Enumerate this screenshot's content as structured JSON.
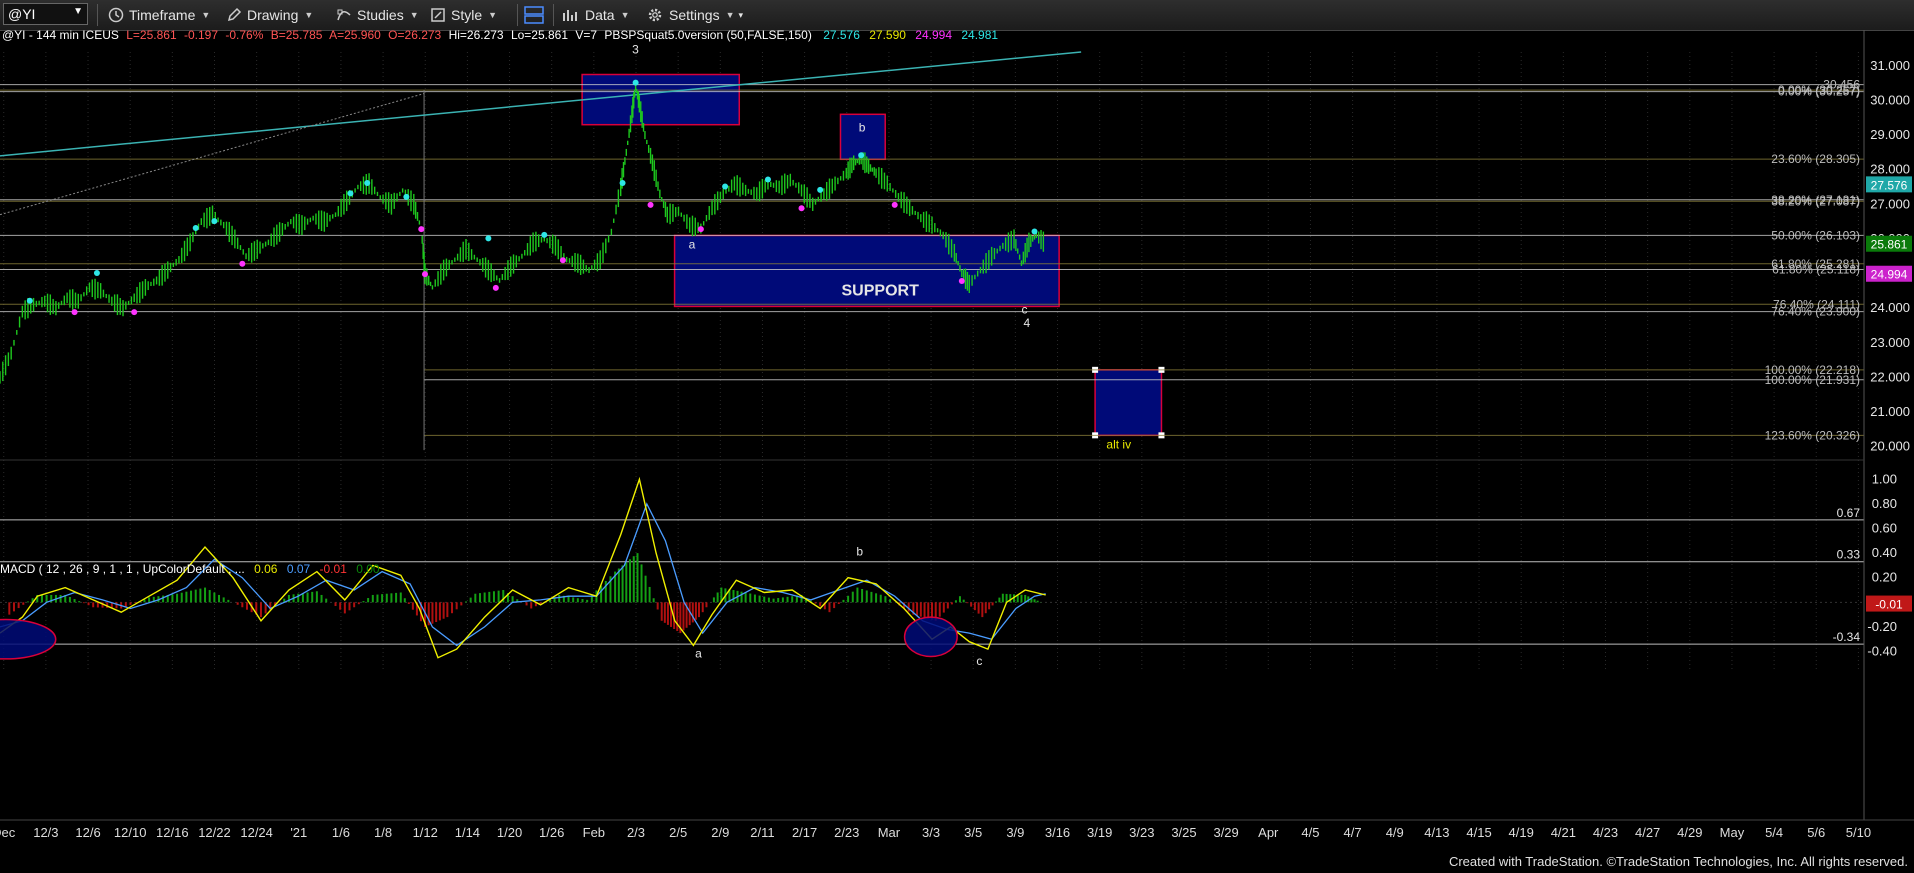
{
  "toolbar": {
    "symbol": "@YI",
    "timeframe": "Timeframe",
    "drawing": "Drawing",
    "studies": "Studies",
    "style": "Style",
    "data": "Data",
    "settings": "Settings"
  },
  "header": {
    "symbol_info": "@YI - 144 min  ICEUS",
    "last": "L=25.861",
    "change": "-0.197",
    "change_pct": "-0.76%",
    "bid": "B=25.785",
    "ask": "A=25.960",
    "open": "O=26.273",
    "high": "Hi=26.273",
    "low": "Lo=25.861",
    "volume": "V=7",
    "indicator": "PBSPSquat5.0version (50,FALSE,150)",
    "ind_vals": [
      "27.576",
      "27.590",
      "24.994",
      "24.981"
    ]
  },
  "macd_header": {
    "label": "MACD ( 12 , 26 , 9 , 1 , 1 , UpColorDefault , ...",
    "vals": [
      "0.06",
      "0.07",
      "-0.01",
      "0.00"
    ]
  },
  "footer": "Created with TradeStation. ©TradeStation Technologies, Inc. All rights reserved.",
  "colors": {
    "up_text": "#ff5555",
    "yellow": "#e8e800",
    "cyan": "#2ee6e6",
    "magenta": "#ff33ff",
    "box": "#000a78",
    "box_border": "#d9003a",
    "hist_up": "#14a014",
    "hist_down": "#b01010"
  },
  "chart_data": {
    "type": "candlestick",
    "price_axis": {
      "ticks": [
        "31.000",
        "30.000",
        "29.000",
        "28.000",
        "27.000",
        "26.000",
        "25.000",
        "24.000",
        "23.000",
        "22.000",
        "21.000",
        "20.000"
      ],
      "range": [
        19.7,
        31.4
      ]
    },
    "date_axis": {
      "ticks": [
        "Dec",
        "12/3",
        "12/6",
        "12/10",
        "12/16",
        "12/22",
        "12/24",
        "'21",
        "1/6",
        "1/8",
        "1/12",
        "1/14",
        "1/20",
        "1/26",
        "Feb",
        "2/3",
        "2/5",
        "2/9",
        "2/11",
        "2/17",
        "2/23",
        "Mar",
        "3/3",
        "3/5",
        "3/9",
        "3/16",
        "3/19",
        "3/23",
        "3/25",
        "3/29",
        "Apr",
        "4/5",
        "4/7",
        "4/9",
        "4/13",
        "4/15",
        "4/19",
        "4/21",
        "4/23",
        "4/27",
        "4/29",
        "May",
        "5/4",
        "5/6",
        "5/10"
      ]
    },
    "price_labels": [
      {
        "text": "27.576",
        "value": 27.576,
        "bg": "#1fa8a8",
        "fg": "#fff"
      },
      {
        "text": "25.861",
        "value": 25.861,
        "bg": "#0a7a0a",
        "fg": "#fff"
      },
      {
        "text": "24.994",
        "value": 24.994,
        "bg": "#cc22cc",
        "fg": "#fff"
      }
    ],
    "fib_levels": [
      {
        "text": "30.456",
        "value": 30.456
      },
      {
        "text": "0.00% (30.257)",
        "value": 30.3
      },
      {
        "text": "0.00% (30.257)",
        "value": 30.257
      },
      {
        "text": "23.60% (28.305)",
        "value": 28.305
      },
      {
        "text": "38.20% (27.131)",
        "value": 27.131
      },
      {
        "text": "38.20% (27.087)",
        "value": 27.087
      },
      {
        "text": "50.00% (26.103)",
        "value": 26.103
      },
      {
        "text": "61.80% (25.281)",
        "value": 25.281
      },
      {
        "text": "61.80% (25.118)",
        "value": 25.118
      },
      {
        "text": "76.40% (24.111)",
        "value": 24.111
      },
      {
        "text": "76.40% (23.900)",
        "value": 23.9
      },
      {
        "text": "100.00% (22.218)",
        "value": 22.218
      },
      {
        "text": "100.00% (21.931)",
        "value": 21.931
      },
      {
        "text": "123.60% (20.326)",
        "value": 20.326
      }
    ],
    "annotations": [
      {
        "text": "3",
        "t": 0.3409,
        "p": 31.35
      },
      {
        "text": "b",
        "t": 0.4625,
        "p": 29.1
      },
      {
        "text": "a",
        "t": 0.3712,
        "p": 25.73
      },
      {
        "text": "SUPPORT",
        "t": 0.4722,
        "p": 24.37
      },
      {
        "text": "c",
        "t": 0.5496,
        "p": 23.85
      },
      {
        "text": "4",
        "t": 0.5509,
        "p": 23.46
      },
      {
        "text": "alt iv",
        "t": 0.6002,
        "p": 19.95
      }
    ],
    "zones": [
      {
        "label": "3",
        "t0": 0.3123,
        "t1": 0.3966,
        "p0": 29.3,
        "p1": 30.75
      },
      {
        "label": "b",
        "t0": 0.4509,
        "t1": 0.4749,
        "p0": 28.3,
        "p1": 29.6
      },
      {
        "label": "SUPPORT",
        "t0": 0.3619,
        "t1": 0.5682,
        "p0": 24.05,
        "p1": 26.1
      },
      {
        "label": "alt iv",
        "t0": 0.5875,
        "t1": 0.6231,
        "p0": 20.326,
        "p1": 22.218
      }
    ],
    "price_series": [
      [
        0,
        22.0
      ],
      [
        0.006,
        22.7
      ],
      [
        0.012,
        23.9
      ],
      [
        0.018,
        24.1
      ],
      [
        0.024,
        24.2
      ],
      [
        0.03,
        24.0
      ],
      [
        0.036,
        24.3
      ],
      [
        0.042,
        24.2
      ],
      [
        0.048,
        24.6
      ],
      [
        0.054,
        24.5
      ],
      [
        0.06,
        24.2
      ],
      [
        0.066,
        24.0
      ],
      [
        0.072,
        24.3
      ],
      [
        0.078,
        24.6
      ],
      [
        0.084,
        24.8
      ],
      [
        0.09,
        25.1
      ],
      [
        0.096,
        25.4
      ],
      [
        0.102,
        25.9
      ],
      [
        0.108,
        26.5
      ],
      [
        0.114,
        26.7
      ],
      [
        0.12,
        26.4
      ],
      [
        0.126,
        26.0
      ],
      [
        0.132,
        25.5
      ],
      [
        0.138,
        25.7
      ],
      [
        0.144,
        25.9
      ],
      [
        0.15,
        26.2
      ],
      [
        0.156,
        26.5
      ],
      [
        0.162,
        26.4
      ],
      [
        0.168,
        26.6
      ],
      [
        0.174,
        26.5
      ],
      [
        0.18,
        26.7
      ],
      [
        0.186,
        27.1
      ],
      [
        0.192,
        27.5
      ],
      [
        0.198,
        27.6
      ],
      [
        0.204,
        27.2
      ],
      [
        0.21,
        27.0
      ],
      [
        0.216,
        27.4
      ],
      [
        0.222,
        27.0
      ],
      [
        0.226,
        26.3
      ],
      [
        0.228,
        25.0
      ],
      [
        0.232,
        24.6
      ],
      [
        0.238,
        25.1
      ],
      [
        0.244,
        25.4
      ],
      [
        0.25,
        25.7
      ],
      [
        0.256,
        25.4
      ],
      [
        0.262,
        25.1
      ],
      [
        0.268,
        24.8
      ],
      [
        0.274,
        25.2
      ],
      [
        0.28,
        25.5
      ],
      [
        0.286,
        25.9
      ],
      [
        0.292,
        26.0
      ],
      [
        0.298,
        25.8
      ],
      [
        0.304,
        25.4
      ],
      [
        0.31,
        25.3
      ],
      [
        0.316,
        25.1
      ],
      [
        0.322,
        25.4
      ],
      [
        0.328,
        26.2
      ],
      [
        0.333,
        27.5
      ],
      [
        0.336,
        28.5
      ],
      [
        0.339,
        29.6
      ],
      [
        0.341,
        30.4
      ],
      [
        0.343,
        29.9
      ],
      [
        0.346,
        29.0
      ],
      [
        0.35,
        28.2
      ],
      [
        0.354,
        27.3
      ],
      [
        0.358,
        26.7
      ],
      [
        0.364,
        26.8
      ],
      [
        0.37,
        26.4
      ],
      [
        0.376,
        26.3
      ],
      [
        0.382,
        26.9
      ],
      [
        0.388,
        27.3
      ],
      [
        0.394,
        27.6
      ],
      [
        0.4,
        27.4
      ],
      [
        0.406,
        27.3
      ],
      [
        0.412,
        27.6
      ],
      [
        0.418,
        27.5
      ],
      [
        0.424,
        27.7
      ],
      [
        0.43,
        27.4
      ],
      [
        0.436,
        27.0
      ],
      [
        0.442,
        27.3
      ],
      [
        0.448,
        27.6
      ],
      [
        0.454,
        27.9
      ],
      [
        0.458,
        28.2
      ],
      [
        0.462,
        28.3
      ],
      [
        0.466,
        28.1
      ],
      [
        0.47,
        27.9
      ],
      [
        0.476,
        27.6
      ],
      [
        0.482,
        27.2
      ],
      [
        0.488,
        26.9
      ],
      [
        0.494,
        26.6
      ],
      [
        0.5,
        26.4
      ],
      [
        0.506,
        26.1
      ],
      [
        0.512,
        25.6
      ],
      [
        0.516,
        25.0
      ],
      [
        0.52,
        24.7
      ],
      [
        0.526,
        25.1
      ],
      [
        0.532,
        25.5
      ],
      [
        0.538,
        25.8
      ],
      [
        0.544,
        26.0
      ],
      [
        0.548,
        25.3
      ],
      [
        0.552,
        25.9
      ],
      [
        0.556,
        26.1
      ],
      [
        0.561,
        25.86
      ]
    ],
    "pivots_high": [
      [
        0.016,
        24.1
      ],
      [
        0.052,
        24.9
      ],
      [
        0.105,
        26.2
      ],
      [
        0.115,
        26.4
      ],
      [
        0.188,
        27.2
      ],
      [
        0.197,
        27.5
      ],
      [
        0.218,
        27.1
      ],
      [
        0.262,
        25.9
      ],
      [
        0.292,
        26.0
      ],
      [
        0.334,
        27.5
      ],
      [
        0.341,
        30.4
      ],
      [
        0.389,
        27.4
      ],
      [
        0.412,
        27.6
      ],
      [
        0.44,
        27.3
      ],
      [
        0.462,
        28.3
      ],
      [
        0.555,
        26.1
      ]
    ],
    "pivots_low": [
      [
        0.04,
        24.0
      ],
      [
        0.072,
        24.0
      ],
      [
        0.13,
        25.4
      ],
      [
        0.226,
        26.4
      ],
      [
        0.228,
        25.1
      ],
      [
        0.266,
        24.7
      ],
      [
        0.302,
        25.5
      ],
      [
        0.349,
        27.1
      ],
      [
        0.376,
        26.4
      ],
      [
        0.43,
        27.0
      ],
      [
        0.48,
        27.1
      ],
      [
        0.516,
        24.9
      ]
    ],
    "macd": {
      "ticks": [
        "1.00",
        "0.80",
        "0.60",
        "0.40",
        "0.20",
        "0.00",
        "-0.20",
        "-0.40"
      ],
      "range": [
        -0.55,
        1.1
      ],
      "hlines": [
        {
          "value": 0.67,
          "label": "0.67"
        },
        {
          "value": 0.33,
          "label": "0.33"
        },
        {
          "value": -0.34,
          "label": "-0.34"
        }
      ],
      "last_label": {
        "text": "-0.01",
        "value": -0.01
      },
      "annotations": [
        {
          "text": "b",
          "t": 0.4612,
          "v": 0.38
        },
        {
          "text": "a",
          "t": 0.3747,
          "v": -0.45
        },
        {
          "text": "c",
          "t": 0.5254,
          "v": -0.51
        }
      ],
      "ellipses": [
        {
          "t": 0.0029,
          "v": -0.3,
          "rt": 0.027,
          "rv": 0.16
        },
        {
          "t": 0.4994,
          "v": -0.28,
          "rt": 0.0141,
          "rv": 0.16
        }
      ],
      "macd_line": [
        [
          0,
          -0.25
        ],
        [
          0.012,
          -0.12
        ],
        [
          0.02,
          0.05
        ],
        [
          0.035,
          0.12
        ],
        [
          0.05,
          0.02
        ],
        [
          0.065,
          -0.08
        ],
        [
          0.08,
          0.05
        ],
        [
          0.095,
          0.18
        ],
        [
          0.11,
          0.45
        ],
        [
          0.125,
          0.2
        ],
        [
          0.14,
          -0.15
        ],
        [
          0.155,
          0.1
        ],
        [
          0.17,
          0.25
        ],
        [
          0.185,
          0.02
        ],
        [
          0.2,
          0.3
        ],
        [
          0.215,
          0.22
        ],
        [
          0.225,
          -0.05
        ],
        [
          0.235,
          -0.45
        ],
        [
          0.245,
          -0.38
        ],
        [
          0.26,
          -0.12
        ],
        [
          0.275,
          0.1
        ],
        [
          0.29,
          -0.02
        ],
        [
          0.305,
          0.12
        ],
        [
          0.32,
          0.05
        ],
        [
          0.333,
          0.55
        ],
        [
          0.343,
          1.0
        ],
        [
          0.352,
          0.4
        ],
        [
          0.362,
          -0.15
        ],
        [
          0.372,
          -0.35
        ],
        [
          0.382,
          -0.1
        ],
        [
          0.395,
          0.18
        ],
        [
          0.41,
          0.08
        ],
        [
          0.425,
          0.1
        ],
        [
          0.44,
          -0.05
        ],
        [
          0.455,
          0.2
        ],
        [
          0.47,
          0.15
        ],
        [
          0.485,
          -0.05
        ],
        [
          0.5,
          -0.3
        ],
        [
          0.51,
          -0.2
        ],
        [
          0.52,
          -0.32
        ],
        [
          0.53,
          -0.38
        ],
        [
          0.54,
          0.0
        ],
        [
          0.55,
          0.1
        ],
        [
          0.561,
          0.06
        ]
      ],
      "signal_line": [
        [
          0,
          -0.2
        ],
        [
          0.012,
          -0.15
        ],
        [
          0.025,
          0.0
        ],
        [
          0.04,
          0.08
        ],
        [
          0.055,
          0.02
        ],
        [
          0.07,
          -0.05
        ],
        [
          0.085,
          0.02
        ],
        [
          0.1,
          0.12
        ],
        [
          0.115,
          0.35
        ],
        [
          0.13,
          0.2
        ],
        [
          0.145,
          -0.05
        ],
        [
          0.16,
          0.05
        ],
        [
          0.175,
          0.18
        ],
        [
          0.19,
          0.1
        ],
        [
          0.205,
          0.25
        ],
        [
          0.22,
          0.15
        ],
        [
          0.232,
          -0.2
        ],
        [
          0.245,
          -0.35
        ],
        [
          0.26,
          -0.2
        ],
        [
          0.275,
          0.0
        ],
        [
          0.29,
          0.02
        ],
        [
          0.305,
          0.05
        ],
        [
          0.32,
          0.05
        ],
        [
          0.335,
          0.3
        ],
        [
          0.347,
          0.8
        ],
        [
          0.357,
          0.5
        ],
        [
          0.367,
          0.0
        ],
        [
          0.377,
          -0.25
        ],
        [
          0.39,
          0.0
        ],
        [
          0.405,
          0.12
        ],
        [
          0.42,
          0.08
        ],
        [
          0.435,
          0.02
        ],
        [
          0.45,
          0.1
        ],
        [
          0.465,
          0.18
        ],
        [
          0.48,
          0.05
        ],
        [
          0.495,
          -0.15
        ],
        [
          0.508,
          -0.22
        ],
        [
          0.52,
          -0.25
        ],
        [
          0.532,
          -0.3
        ],
        [
          0.545,
          -0.05
        ],
        [
          0.555,
          0.05
        ],
        [
          0.561,
          0.07
        ]
      ],
      "histogram": [
        [
          0.005,
          -0.1
        ],
        [
          0.02,
          0.06
        ],
        [
          0.035,
          0.06
        ],
        [
          0.05,
          -0.04
        ],
        [
          0.065,
          -0.05
        ],
        [
          0.08,
          0.04
        ],
        [
          0.095,
          0.07
        ],
        [
          0.11,
          0.12
        ],
        [
          0.125,
          0.0
        ],
        [
          0.14,
          -0.12
        ],
        [
          0.155,
          0.06
        ],
        [
          0.17,
          0.09
        ],
        [
          0.185,
          -0.09
        ],
        [
          0.2,
          0.06
        ],
        [
          0.215,
          0.08
        ],
        [
          0.228,
          -0.2
        ],
        [
          0.24,
          -0.12
        ],
        [
          0.255,
          0.07
        ],
        [
          0.27,
          0.1
        ],
        [
          0.285,
          -0.05
        ],
        [
          0.3,
          0.06
        ],
        [
          0.315,
          0.02
        ],
        [
          0.33,
          0.25
        ],
        [
          0.342,
          0.4
        ],
        [
          0.355,
          -0.15
        ],
        [
          0.365,
          -0.25
        ],
        [
          0.375,
          -0.12
        ],
        [
          0.387,
          0.12
        ],
        [
          0.4,
          0.08
        ],
        [
          0.415,
          0.03
        ],
        [
          0.43,
          0.06
        ],
        [
          0.445,
          -0.08
        ],
        [
          0.46,
          0.12
        ],
        [
          0.475,
          0.05
        ],
        [
          0.49,
          -0.1
        ],
        [
          0.502,
          -0.15
        ],
        [
          0.515,
          0.05
        ],
        [
          0.527,
          -0.12
        ],
        [
          0.538,
          0.07
        ],
        [
          0.55,
          0.06
        ],
        [
          0.56,
          -0.01
        ]
      ]
    }
  }
}
